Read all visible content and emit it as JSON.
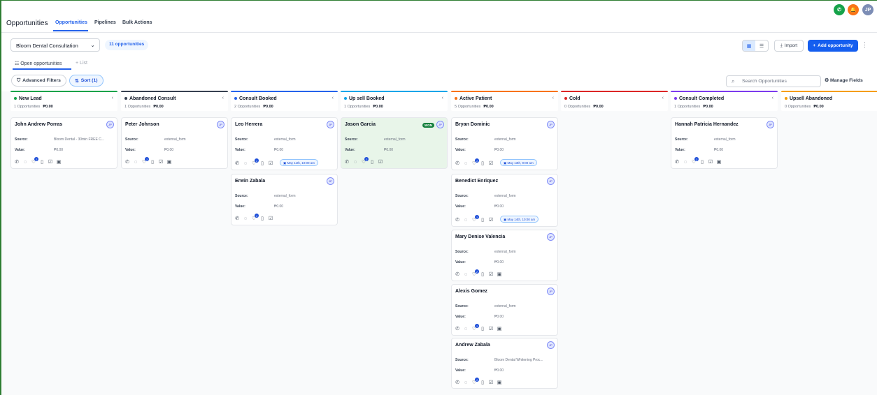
{
  "header": {
    "title": "Opportunities",
    "tabs": [
      {
        "label": "Opportunities"
      },
      {
        "label": "Pipelines"
      },
      {
        "label": "Bulk Actions"
      }
    ],
    "phone_icon_color": "#16a34a",
    "bell_icon_color": "#f97316",
    "user_initials": "JP"
  },
  "controls": {
    "pipeline_select": "Bloom Dental Consultation",
    "opportunity_count": "11 opportunities",
    "import_label": "Import",
    "add_label": "Add opportunity",
    "subtabs": {
      "open": "Open opportunities",
      "list": "List"
    },
    "filters_label": "Advanced Filters",
    "sort_label": "Sort (1)",
    "search_placeholder": "Search Opportunities",
    "manage_fields_label": "Manage Fields"
  },
  "columns": [
    {
      "name": "New Lead",
      "count": "1 Opportunities",
      "amount": "₱0.00",
      "color": "#16a34a"
    },
    {
      "name": "Abandoned Consult",
      "count": "1 Opportunities",
      "amount": "₱0.00",
      "color": "#374151"
    },
    {
      "name": "Consult Booked",
      "count": "2 Opportunities",
      "amount": "₱0.00",
      "color": "#2563eb"
    },
    {
      "name": "Up sell Booked",
      "count": "1 Opportunities",
      "amount": "₱0.00",
      "color": "#0ea5e9"
    },
    {
      "name": "Active Patient",
      "count": "5 Opportunities",
      "amount": "₱0.00",
      "color": "#f97316"
    },
    {
      "name": "Cold",
      "count": "0 Opportunities",
      "amount": "₱0.00",
      "color": "#dc2626"
    },
    {
      "name": "Consult Completed",
      "count": "1 Opportunities",
      "amount": "₱0.00",
      "color": "#7c3aed"
    },
    {
      "name": "Upsell Abandoned",
      "count": "0 Opportunities",
      "amount": "₱0.00",
      "color": "#f59e0b"
    }
  ],
  "card_labels": {
    "source": "Source:",
    "value": "Value:",
    "won": "WON",
    "avatar": "JP"
  },
  "cards": [
    {
      "name": "John Andrew Porras",
      "source": "Bloom Dental - 30min FREE C...",
      "value": "₱0.00",
      "badge": "2"
    },
    {
      "name": "Peter Johnson",
      "source": "external_form",
      "value": "₱0.00",
      "badge": "1"
    },
    {
      "name": "Leo Herrera",
      "source": "external_form",
      "value": "₱0.00",
      "badge": "1",
      "appointment": "May 11th, 10:00 am"
    },
    {
      "name": "Erwin Zabala",
      "source": "external_form",
      "value": "₱0.00",
      "badge": "1"
    },
    {
      "name": "Jason Garcia",
      "source": "external_form",
      "value": "₱0.00",
      "badge": "2",
      "status": "won"
    },
    {
      "name": "Bryan Dominic",
      "source": "external_form",
      "value": "₱0.00",
      "badge": "1",
      "appointment": "May 13th, 9:00 am"
    },
    {
      "name": "Benedict Enriquez",
      "source": "external_form",
      "value": "₱0.00",
      "badge": "1",
      "appointment": "May 14th, 10:00 am"
    },
    {
      "name": "Mary Denise Valencia",
      "source": "external_form",
      "value": "₱0.00",
      "badge": "2"
    },
    {
      "name": "Alexis Gomez",
      "source": "external_form",
      "value": "₱0.00",
      "badge": "1"
    },
    {
      "name": "Andrew Zabala",
      "source": "Bloom Dental Whitening Proc...",
      "value": "₱0.00",
      "badge": "1"
    },
    {
      "name": "Hannah Patricia Hernandez",
      "source": "external_form",
      "value": "₱0.00",
      "badge": "2"
    }
  ]
}
